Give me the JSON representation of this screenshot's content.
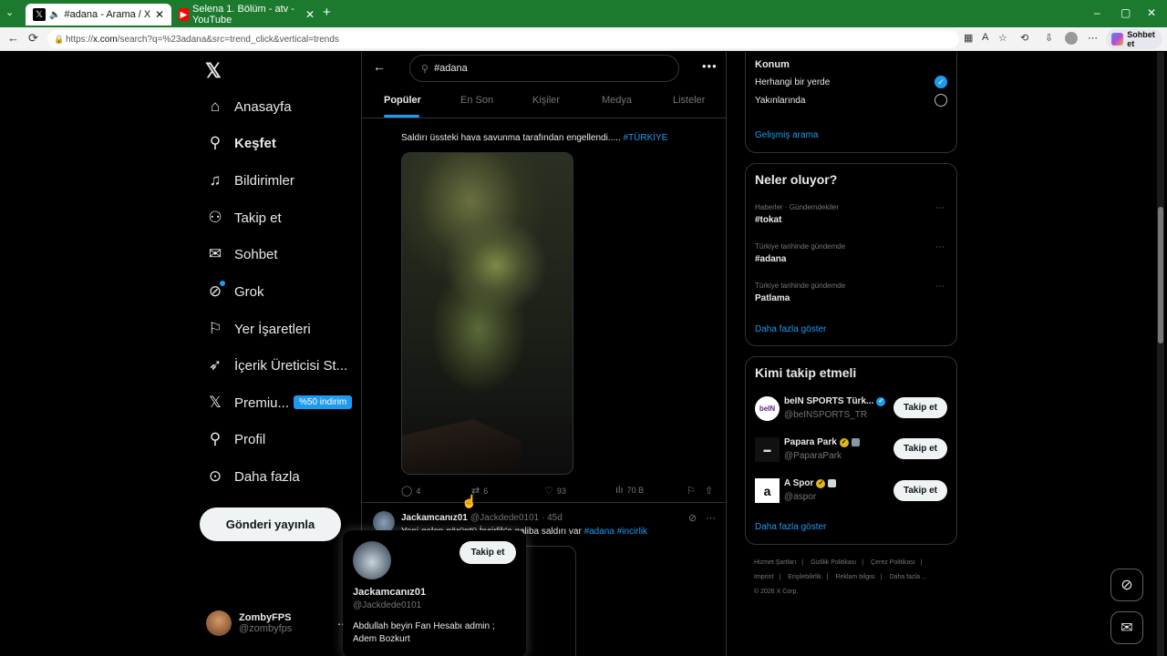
{
  "browser": {
    "tabs": [
      {
        "title": "#adana - Arama / X",
        "active": true
      },
      {
        "title": "Selena 1. Bölüm - atv - YouTube",
        "active": false
      }
    ],
    "url_prefix": "https://",
    "url_host": "x.com",
    "url_path": "/search?q=%23adana&src=trend_click&vertical=trends",
    "chat_button": "Sohbet et",
    "window_controls": [
      "–",
      "▢",
      "✕"
    ],
    "new_tab": "+"
  },
  "nav": {
    "logo": "𝕏",
    "items": [
      {
        "label": "Anasayfa",
        "icon": "⌂"
      },
      {
        "label": "Keşfet",
        "icon": "⚲"
      },
      {
        "label": "Bildirimler",
        "icon": "🔔"
      },
      {
        "label": "Takip et",
        "icon": "👤"
      },
      {
        "label": "Sohbet",
        "icon": "✉"
      },
      {
        "label": "Grok",
        "icon": "⊘"
      },
      {
        "label": "Yer İşaretleri",
        "icon": "🔖"
      },
      {
        "label": "İçerik Üreticisi St...",
        "icon": "🚀"
      },
      {
        "label": "Premiu...",
        "icon": "𝕏"
      },
      {
        "label": "Profil",
        "icon": "👤"
      },
      {
        "label": "Daha fazla",
        "icon": "⋯"
      }
    ],
    "premium_badge": "%50 indirim",
    "post_button": "Gönderi yayınla",
    "account": {
      "name": "ZombyFPS",
      "handle": "@zombyfps"
    }
  },
  "search": {
    "query": "#adana",
    "tabs": [
      "Popüler",
      "En Son",
      "Kişiler",
      "Medya",
      "Listeler"
    ],
    "active_tab": "Popüler"
  },
  "tweet1": {
    "text": "Saldırı üssteki hava savunma tarafından engellendi.....",
    "hashtag": "#TÜRKİYE",
    "replies": "4",
    "reposts": "6",
    "likes": "93",
    "views": "70 B"
  },
  "tweet2": {
    "name": "Jackamcanız01",
    "handle": "@Jackdede0101 · 45d",
    "text_prefix": "Yeni gelen görüntü İncirlik'e galiba saldırı var",
    "hashtag1": "#adana",
    "hashtag2": "#incirlik"
  },
  "hovercard": {
    "follow": "Takip et",
    "name": "Jackamcanız01",
    "handle": "@Jackdede0101",
    "bio": "Abdullah beyin Fan Hesabı  admin ; Adem Bozkurt"
  },
  "location_panel": {
    "title": "Konum",
    "option1": "Herhangi bir yerde",
    "option2": "Yakınlarında",
    "advanced": "Gelişmiş arama"
  },
  "trends": {
    "title": "Neler oluyor?",
    "items": [
      {
        "meta": "Haberler · Gündemdekiler",
        "name": "#tokat"
      },
      {
        "meta": "Türkiye tarihinde gündemde",
        "name": "#adana"
      },
      {
        "meta": "Türkiye tarihinde gündemde",
        "name": "Patlama"
      }
    ],
    "show_more": "Daha fazla göster"
  },
  "who_to_follow": {
    "title": "Kimi takip etmeli",
    "items": [
      {
        "name": "beIN SPORTS Türk...",
        "handle": "@beINSPORTS_TR",
        "button": "Takip et"
      },
      {
        "name": "Papara Park",
        "handle": "@PaparaPark",
        "button": "Takip et"
      },
      {
        "name": "A Spor",
        "handle": "@aspor",
        "button": "Takip et"
      }
    ],
    "show_more": "Daha fazla göster"
  },
  "footer": {
    "links": [
      "Hizmet Şartları",
      "Gizlilik Politikası",
      "Çerez Politikası",
      "Imprint",
      "Erişilebilirlik",
      "Reklam bilgisi",
      "Daha fazla ..."
    ],
    "copyright": "© 2026 X Corp."
  },
  "colors": {
    "accent": "#1d9bf0",
    "background": "#000000",
    "browser_frame": "#1b7a2e"
  }
}
